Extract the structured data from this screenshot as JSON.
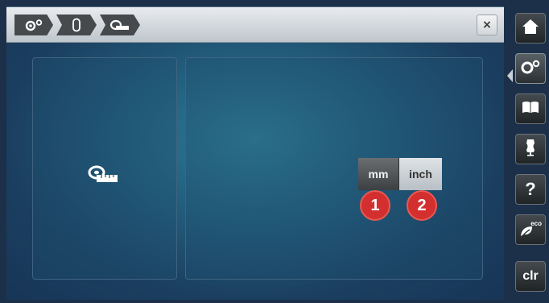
{
  "breadcrumb": [
    {
      "icon": "settings-gears-icon"
    },
    {
      "icon": "bobbin-icon"
    },
    {
      "icon": "measuring-tape-icon"
    }
  ],
  "close_label": "×",
  "unit_selector": {
    "options": [
      "mm",
      "inch"
    ],
    "selected": "mm"
  },
  "callouts": [
    "1",
    "2"
  ],
  "sidebar": {
    "items": [
      {
        "icon": "home-icon"
      },
      {
        "icon": "settings-icon"
      },
      {
        "icon": "tutorial-book-icon"
      },
      {
        "icon": "sewing-consultant-icon"
      },
      {
        "icon": "help-icon",
        "label": "?"
      },
      {
        "icon": "eco-mode-icon",
        "label": "eco"
      },
      {
        "icon": "clear-icon",
        "label": "clr"
      }
    ]
  },
  "colors": {
    "badge": "#d32f2f",
    "background": "#1c3049"
  }
}
